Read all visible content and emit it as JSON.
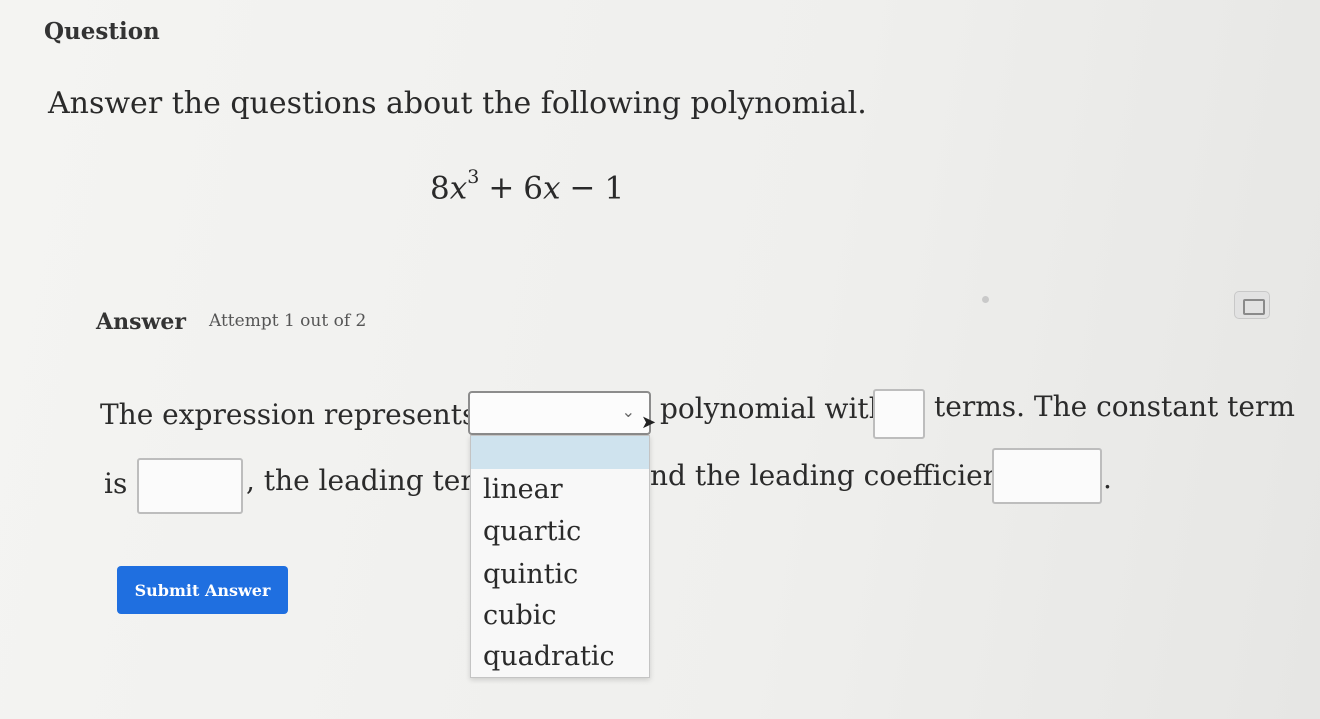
{
  "question": {
    "heading": "Question",
    "prompt": "Answer the questions about the following polynomial.",
    "expression": {
      "term1_coef": "8",
      "term1_var": "x",
      "term1_exp": "3",
      "op1": "+",
      "term2_coef": "6",
      "term2_var": "x",
      "op2": "−",
      "term3": "1"
    }
  },
  "answer": {
    "label": "Answer",
    "attempt": "Attempt 1 out of 2",
    "line1": {
      "seg1": "The expression represents a",
      "seg2": "polynomial with",
      "seg3": "terms. The constant term"
    },
    "line2": {
      "seg1": "is",
      "seg2": ", the leading term",
      "seg3": "nd the leading coefficient is",
      "seg4": "."
    },
    "dropdown": {
      "options": [
        "linear",
        "quartic",
        "quintic",
        "cubic",
        "quadratic"
      ]
    },
    "submit_label": "Submit Answer"
  },
  "colors": {
    "submit_button": "#1f6fe0",
    "dropdown_highlight": "#cfe3ee"
  }
}
